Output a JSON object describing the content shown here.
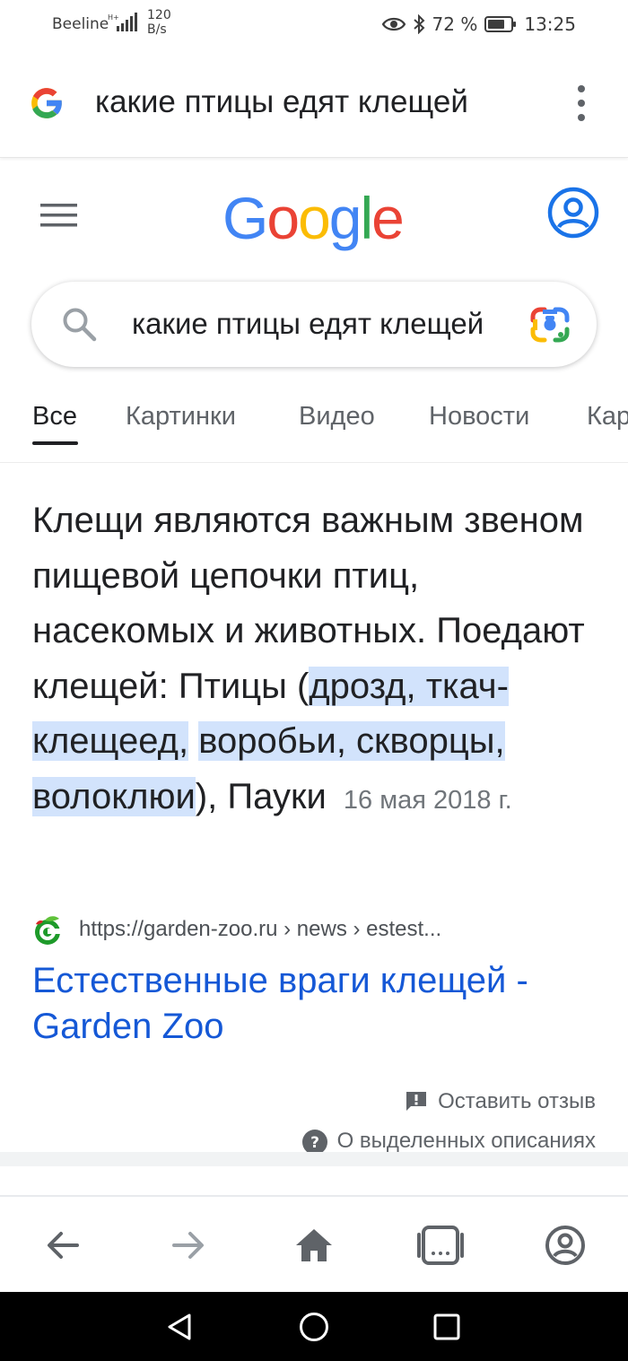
{
  "status_bar": {
    "carrier": "Beeline",
    "net_speed": "120",
    "net_speed_unit": "B/s",
    "battery": "72 %",
    "time": "13:25"
  },
  "app_bar": {
    "query": "какие птицы едят клещей"
  },
  "search": {
    "query": "какие птицы едят клещей"
  },
  "tabs": [
    {
      "label": "Все",
      "active": true
    },
    {
      "label": "Картинки",
      "active": false
    },
    {
      "label": "Видео",
      "active": false
    },
    {
      "label": "Новости",
      "active": false
    },
    {
      "label": "Кар",
      "active": false
    }
  ],
  "snippet": {
    "text_before": "Клещи являются важным звеном пищевой цепочки птиц, насекомых и животных. Поедают клещей: Птицы (",
    "highlight_1": "дрозд, ткач-клещеед,",
    "highlight_2": "воробьи, скворцы,",
    "highlight_3": "волоклюи",
    "text_after": "), Пауки",
    "date": "16 мая 2018 г."
  },
  "source": {
    "url": "https://garden-zoo.ru › news › estest...",
    "title": "Естественные враги клещей - Garden Zoo"
  },
  "feedback": {
    "leave_feedback": "Оставить отзыв",
    "about_snippets": "О выделенных описаниях"
  },
  "colors": {
    "link": "#1558d6",
    "highlight": "#d2e3fc",
    "google_blue": "#4285f4",
    "google_red": "#ea4335",
    "google_yellow": "#fbbc05",
    "google_green": "#34a853",
    "account_blue": "#1a73e8"
  },
  "icons": {
    "app_bar": [
      "google-g-icon",
      "more-vert-icon"
    ],
    "header": [
      "menu-icon",
      "account-icon"
    ],
    "search": [
      "search-icon",
      "google-lens-icon"
    ],
    "bottom_nav": [
      "back-arrow-icon",
      "forward-arrow-icon",
      "home-icon",
      "tabs-icon",
      "profile-icon"
    ],
    "system_nav": [
      "nav-back-icon",
      "nav-home-icon",
      "nav-recents-icon"
    ]
  }
}
